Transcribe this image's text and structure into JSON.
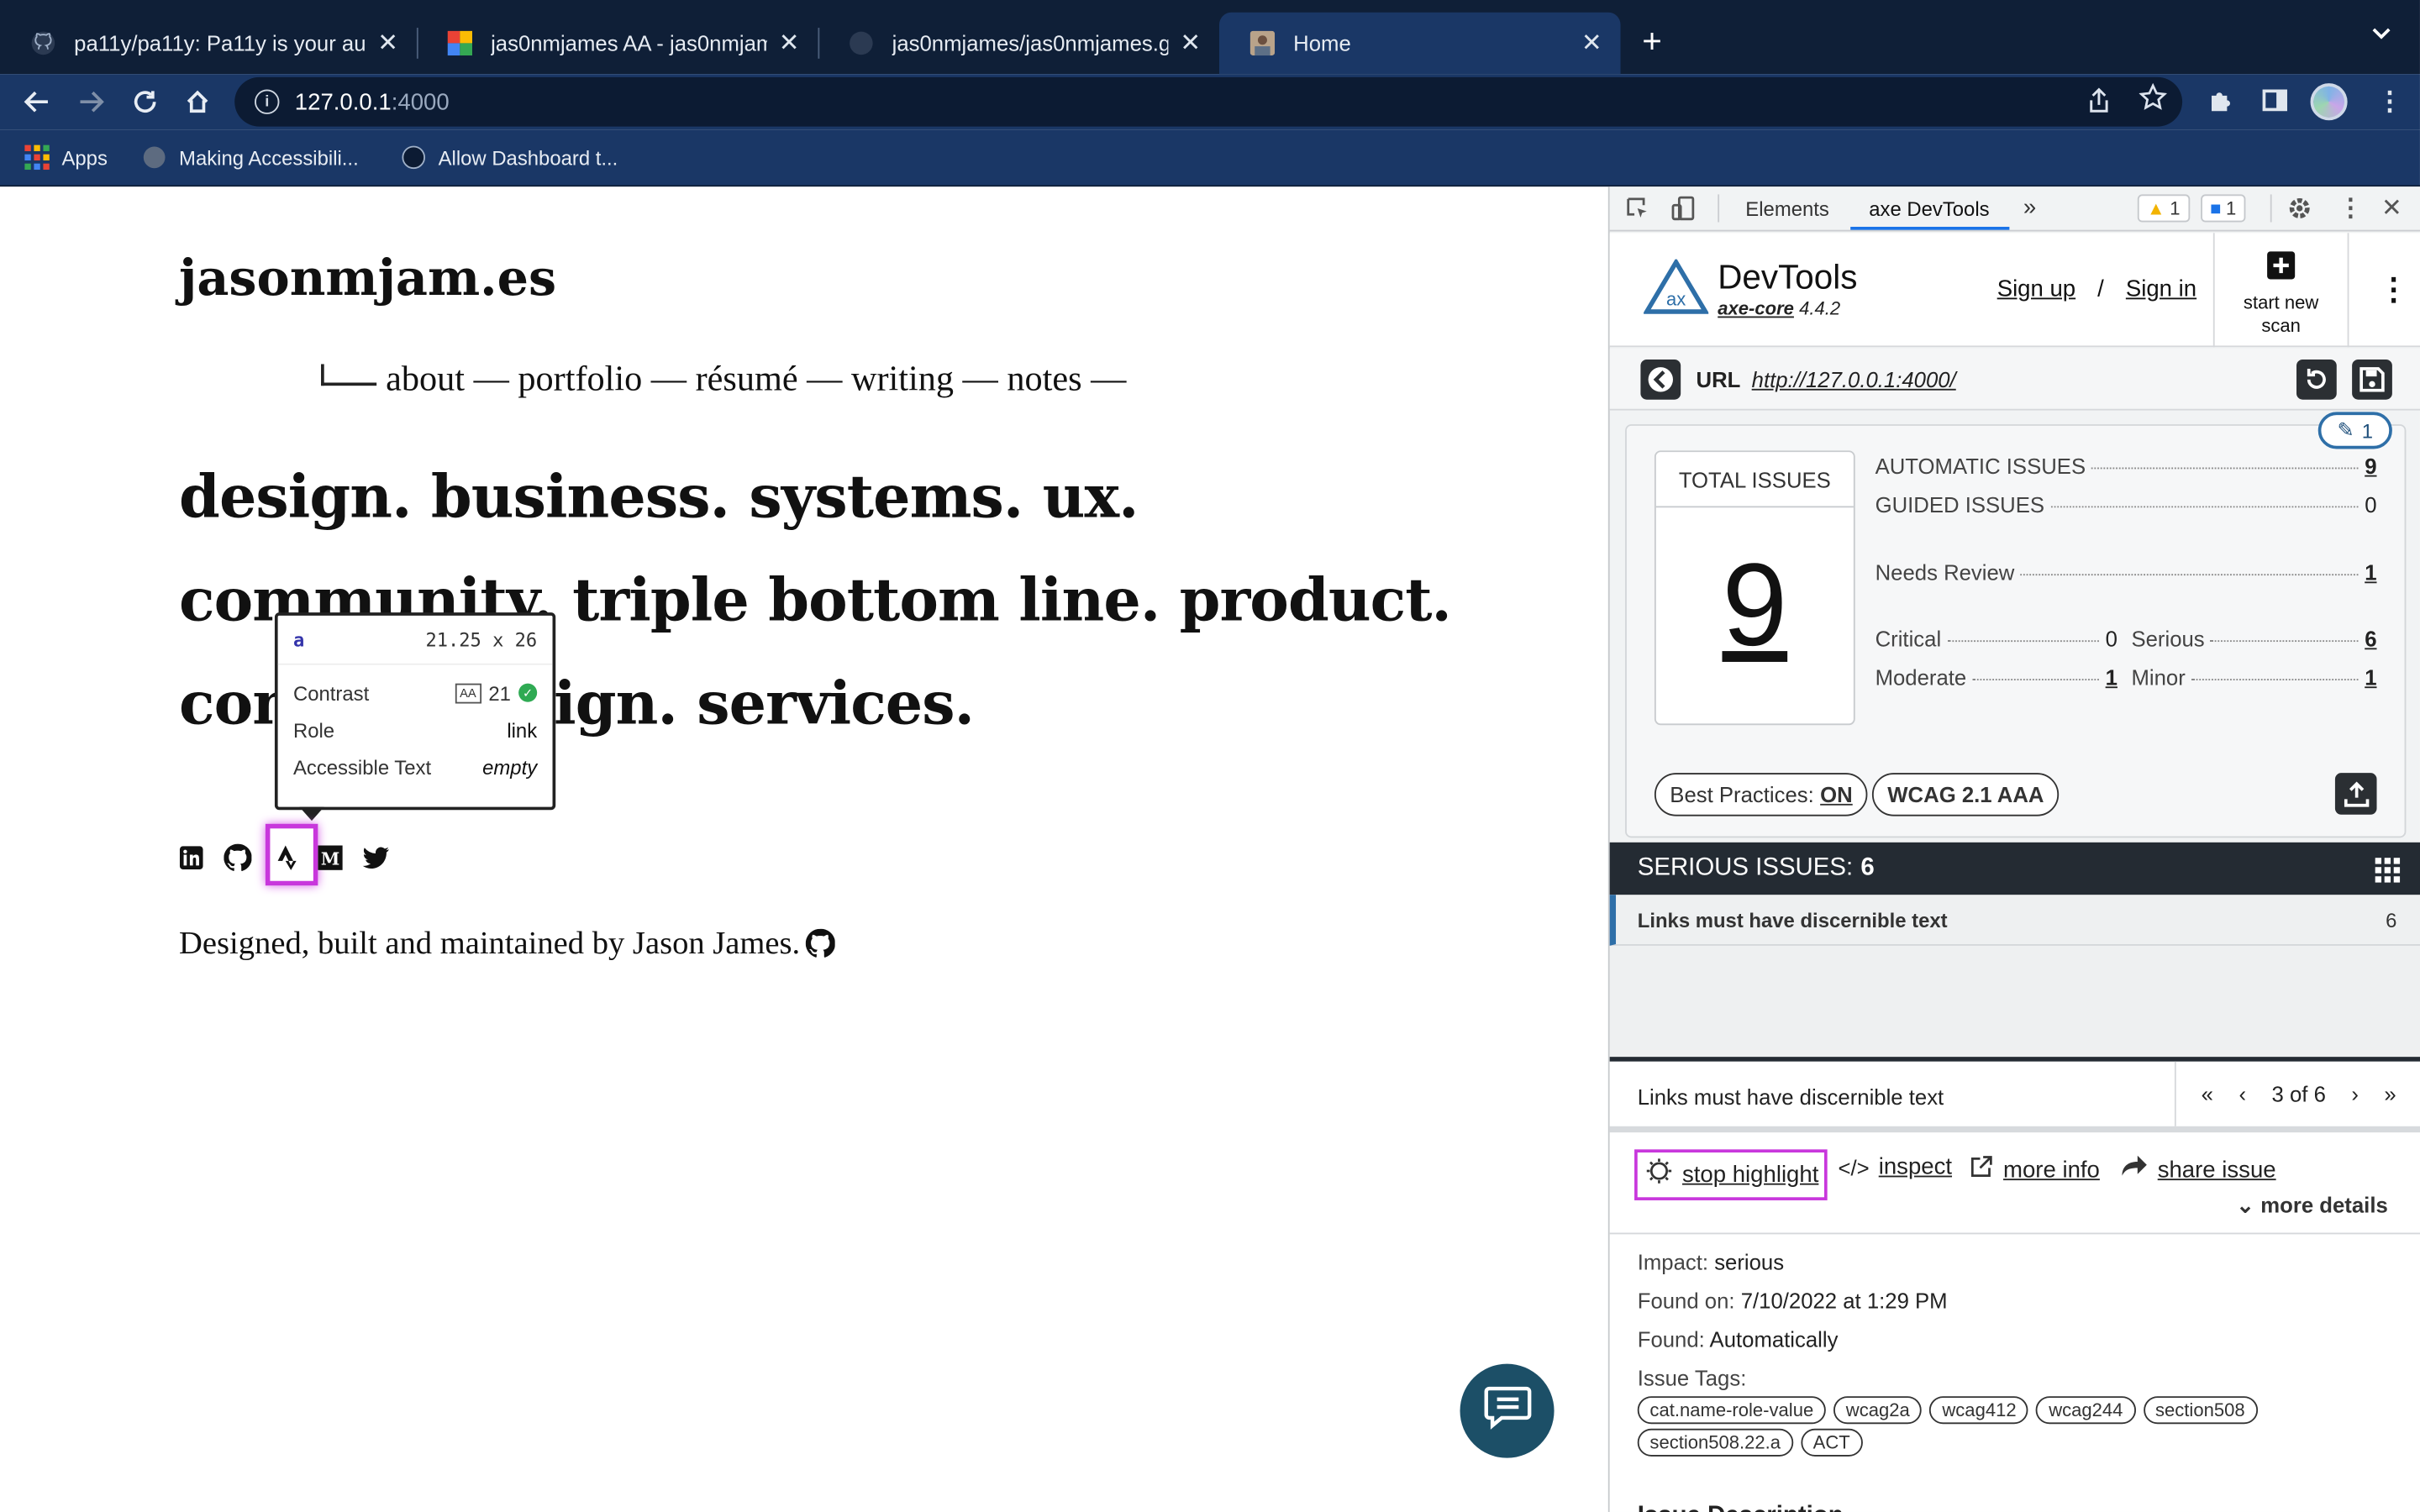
{
  "browser": {
    "tabs": [
      {
        "title": "pa11y/pa11y: Pa11y is your auto",
        "active": false
      },
      {
        "title": "jas0nmjames AA - jas0nmjame",
        "active": false
      },
      {
        "title": "jas0nmjames/jas0nmjames.gith",
        "active": false
      },
      {
        "title": "Home",
        "active": true
      }
    ],
    "address": {
      "host": "127.0.0.1",
      "port": ":4000"
    },
    "bookmarks": [
      "Apps",
      "Making Accessibili...",
      "Allow Dashboard t..."
    ]
  },
  "page": {
    "logo": "jasonmjam.es",
    "nav": "about — portfolio — résumé — writing — notes —",
    "headline": [
      "design. business. systems. ux.",
      "community. triple bottom line. product.",
      "content design. services."
    ],
    "footer": "Designed, built and maintained by Jason James.",
    "tooltip": {
      "tag": "a",
      "size": "21.25 x 26",
      "contrast_label": "Contrast",
      "contrast_badge": "AA",
      "contrast_value": "21",
      "role_label": "Role",
      "role_value": "link",
      "text_label": "Accessible Text",
      "text_value": "empty"
    },
    "social_icons": [
      "linkedin-icon",
      "github-icon",
      "strava-icon",
      "medium-icon",
      "twitter-icon"
    ]
  },
  "devtools": {
    "tabs": [
      "Elements",
      "axe DevTools"
    ],
    "warnings": "1",
    "messages": "1",
    "axe": {
      "title": "DevTools",
      "core_name": "axe-core",
      "core_version": "4.4.2",
      "sign_up": "Sign up",
      "slash": "/",
      "sign_in": "Sign in",
      "start_scan": "start new scan",
      "url_label": "URL",
      "url": "http://127.0.0.1:4000/",
      "guided_count": "1",
      "total_label": "TOTAL ISSUES",
      "total": "9",
      "automatic_label": "AUTOMATIC ISSUES",
      "automatic": "9",
      "guided_label": "GUIDED ISSUES",
      "guided": "0",
      "needs_review_label": "Needs Review",
      "needs_review": "1",
      "critical_label": "Critical",
      "critical": "0",
      "serious_label": "Serious",
      "serious": "6",
      "moderate_label": "Moderate",
      "moderate": "1",
      "minor_label": "Minor",
      "minor": "1",
      "best_practices_label": "Best Practices:",
      "best_practices": "ON",
      "standard": "WCAG 2.1 AAA",
      "serious_header": "SERIOUS ISSUES:",
      "serious_header_count": "6",
      "issue_title": "Links must have discernible text",
      "issue_count": "6",
      "pager": "3 of 6",
      "actions": {
        "stop": "stop highlight",
        "inspect": "inspect",
        "more_info": "more info",
        "share": "share issue",
        "more_details": "more details"
      },
      "impact_label": "Impact:",
      "impact": "serious",
      "found_on_label": "Found on:",
      "found_on": "7/10/2022 at 1:29 PM",
      "found_label": "Found:",
      "found": "Automatically",
      "tags_label": "Issue Tags:",
      "tags": [
        "cat.name-role-value",
        "wcag2a",
        "wcag412",
        "wcag244",
        "section508",
        "section508.22.a",
        "ACT"
      ],
      "next_heading": "Issue Description"
    }
  },
  "colors": {
    "highlight": "#c837dc",
    "accent": "#2e6fa8",
    "chrome": "#1a3766"
  }
}
